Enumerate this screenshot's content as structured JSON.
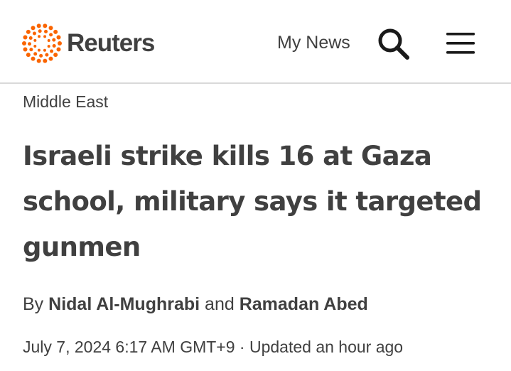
{
  "header": {
    "brand": "Reuters",
    "my_news_label": "My News",
    "brand_color": "#fa6400",
    "text_color": "#404040"
  },
  "article": {
    "section": "Middle East",
    "headline": "Israeli strike kills 16 at Gaza school, military says it targeted gunmen",
    "byline": {
      "prefix": "By",
      "author1": "Nidal Al-Mughrabi",
      "conjunction": "and",
      "author2": "Ramadan Abed"
    },
    "date": "July 7, 2024 6:17 AM GMT+9",
    "separator": "·",
    "updated": "Updated an hour ago"
  }
}
